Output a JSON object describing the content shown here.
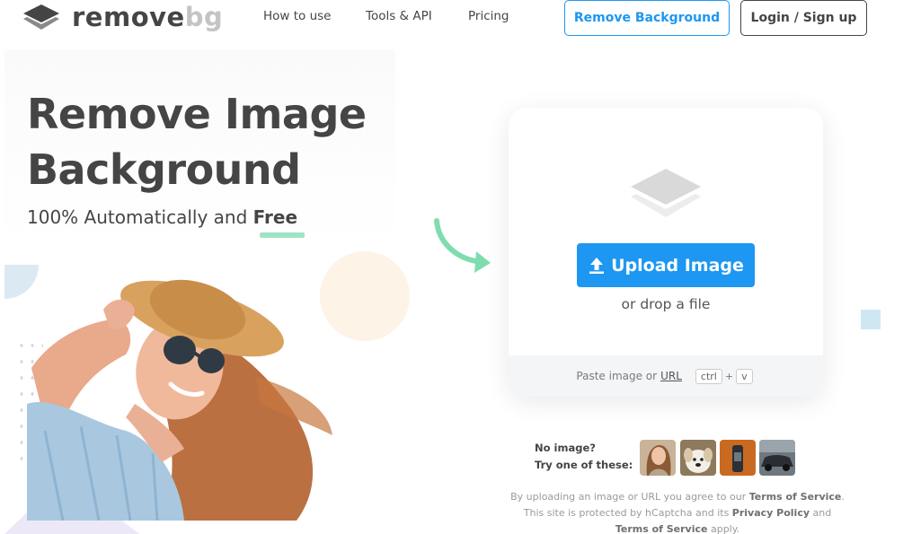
{
  "header": {
    "logo": {
      "word_main": "remove",
      "word_accent": "bg"
    },
    "nav": [
      {
        "label": "How to use"
      },
      {
        "label": "Tools & API"
      },
      {
        "label": "Pricing"
      }
    ],
    "remove_background_label": "Remove Background",
    "login_label": "Login / Sign up"
  },
  "hero": {
    "title_line1": "Remove Image",
    "title_line2": "Background",
    "subtitle_prefix": "100% Automatically and ",
    "subtitle_free": "Free"
  },
  "upload": {
    "button_label": "Upload Image",
    "drop_text": "or drop a file",
    "paste_prefix": "Paste image or",
    "paste_url": "URL",
    "kbd_ctrl": "ctrl",
    "kbd_plus": "+",
    "kbd_v": "v"
  },
  "samples": {
    "line1": "No image?",
    "line2": "Try one of these:",
    "thumbnails": [
      "woman-thumb",
      "dog-thumb",
      "bottle-thumb",
      "car-thumb"
    ]
  },
  "legal": {
    "part1": "By uploading an image or URL you agree to our ",
    "terms1": "Terms of Service",
    "part2": ". This site is protected by hCaptcha and its ",
    "privacy": "Privacy Policy",
    "part3": " and ",
    "terms2": "Terms of Service",
    "part4": " apply."
  },
  "colors": {
    "accent_blue": "#1d97f1",
    "text_dark": "#454545",
    "underline_green": "#9ee4c4",
    "arrow_green": "#7fdcae"
  }
}
